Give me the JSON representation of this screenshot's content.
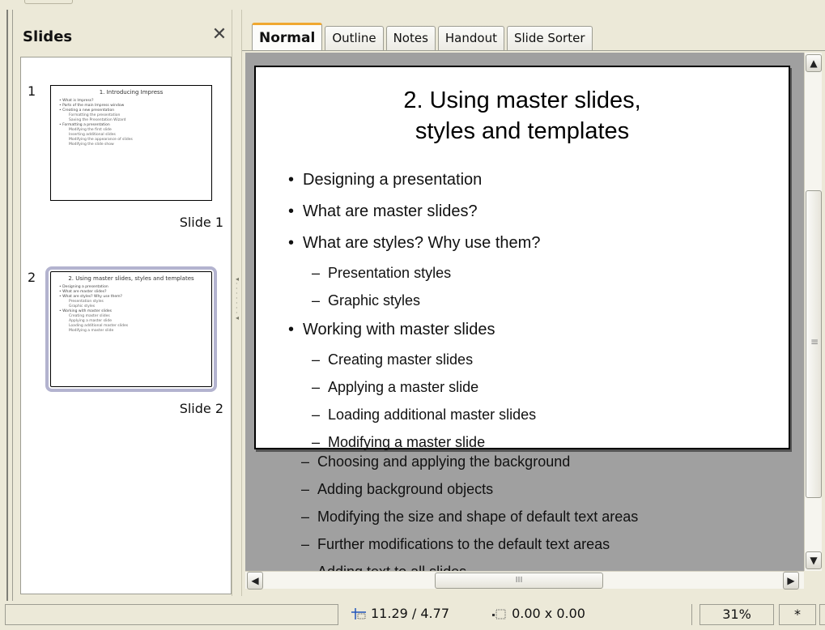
{
  "panel": {
    "title": "Slides",
    "close_symbol": "✕",
    "slides": [
      {
        "number": "1",
        "caption": "Slide 1",
        "thumb_title": "1. Introducing Impress",
        "thumb_lines": [
          {
            "text": "• What is Impress?",
            "sub": false
          },
          {
            "text": "• Parts of the main Impress window",
            "sub": false
          },
          {
            "text": "• Creating a new presentation",
            "sub": false
          },
          {
            "text": "Formatting the presentation",
            "sub": true
          },
          {
            "text": "Saving the Presentation Wizard",
            "sub": true
          },
          {
            "text": "• Formatting a presentation",
            "sub": false
          },
          {
            "text": "Modifying the first slide",
            "sub": true
          },
          {
            "text": "Inserting additional slides",
            "sub": true
          },
          {
            "text": "Modifying the appearance of slides",
            "sub": true
          },
          {
            "text": "Modifying the slide show",
            "sub": true
          }
        ]
      },
      {
        "number": "2",
        "caption": "Slide 2",
        "thumb_title": "2. Using master slides, styles and templates",
        "thumb_lines": [
          {
            "text": "• Designing a presentation",
            "sub": false
          },
          {
            "text": "• What are master slides?",
            "sub": false
          },
          {
            "text": "• What are styles? Why use them?",
            "sub": false
          },
          {
            "text": "Presentation styles",
            "sub": true
          },
          {
            "text": "Graphic styles",
            "sub": true
          },
          {
            "text": "• Working with master slides",
            "sub": false
          },
          {
            "text": "Creating master slides",
            "sub": true
          },
          {
            "text": "Applying a master slide",
            "sub": true
          },
          {
            "text": "Loading additional master slides",
            "sub": true
          },
          {
            "text": "Modifying a master slide",
            "sub": true
          }
        ]
      }
    ]
  },
  "tabs": [
    {
      "label": "Normal",
      "active": true
    },
    {
      "label": "Outline",
      "active": false
    },
    {
      "label": "Notes",
      "active": false
    },
    {
      "label": "Handout",
      "active": false
    },
    {
      "label": "Slide Sorter",
      "active": false
    }
  ],
  "slide": {
    "title_line1": "2. Using master slides,",
    "title_line2": "styles and templates",
    "items": [
      {
        "text": "Designing a presentation",
        "level": 1
      },
      {
        "text": "What are master slides?",
        "level": 1
      },
      {
        "text": "What are styles? Why use them?",
        "level": 1
      },
      {
        "text": "Presentation styles",
        "level": 2
      },
      {
        "text": "Graphic styles",
        "level": 2
      },
      {
        "text": "Working with master slides",
        "level": 1
      },
      {
        "text": "Creating master slides",
        "level": 2
      },
      {
        "text": "Applying a master slide",
        "level": 2
      },
      {
        "text": "Loading additional master slides",
        "level": 2
      },
      {
        "text": "Modifying a master slide",
        "level": 2
      }
    ],
    "overflow_items": [
      {
        "text": "Choosing and applying the background",
        "level": 2
      },
      {
        "text": "Adding background objects",
        "level": 2
      },
      {
        "text": "Modifying the size and shape of default text areas",
        "level": 2
      },
      {
        "text": "Further modifications to the default text areas",
        "level": 2
      },
      {
        "text": "Adding text to all slides",
        "level": 2
      }
    ]
  },
  "scrollbars": {
    "up_symbol": "▲",
    "down_symbol": "▼",
    "left_symbol": "◀",
    "right_symbol": "▶",
    "h_grip": "III",
    "v_grip": "≡"
  },
  "status": {
    "position": "11.29 / 4.77",
    "size": "0.00 x 0.00",
    "zoom": "31%",
    "modified": "*"
  },
  "colors": {
    "active_tab_accent": "#f0a830",
    "workspace": "#a0a0a0",
    "chrome": "#ece9d8",
    "selection_outline": "#b3b3cf"
  },
  "icons": [
    "close-icon",
    "position-icon",
    "size-icon",
    "scroll-up-icon",
    "scroll-down-icon",
    "scroll-left-icon",
    "scroll-right-icon"
  ]
}
